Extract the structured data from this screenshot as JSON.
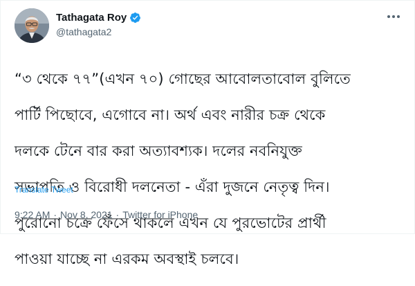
{
  "tweet": {
    "author": {
      "display_name": "Tathagata Roy",
      "handle": "@tathagata2",
      "verified": true,
      "avatar_icon": "profile-photo"
    },
    "text_lines": [
      "“৩ থেকে ৭৭”(এখন ৭০) গোছের আবোলতাবোল বুলিতে",
      "পার্টি পিছোবে, এগোবে না। অর্থ এবং নারীর চক্র থেকে",
      "দলকে টেনে বার করা অত্যাবশ্যক। দলের নবনিযুক্ত",
      "সভাপতি ও বিরোধী দলনেতা - এঁরা দুজনে নেতৃত্ব দিন।",
      "পুরোনো চক্রে ফেঁসে থাকলে এখন যে পুরভোটের প্রার্থী",
      "পাওয়া যাচ্ছে না এরকম অবস্থাই চলবে।"
    ],
    "translate_label": "Translate Tweet",
    "time": "9:22 AM",
    "separator": "·",
    "date": "Nov 8, 2021",
    "source": "Twitter for iPhone"
  },
  "colors": {
    "accent": "#1d9bf0",
    "secondary_text": "#536471",
    "primary_text": "#0f1419"
  },
  "icons": {
    "verified": "verified-badge-icon",
    "more": "more-options-icon"
  }
}
